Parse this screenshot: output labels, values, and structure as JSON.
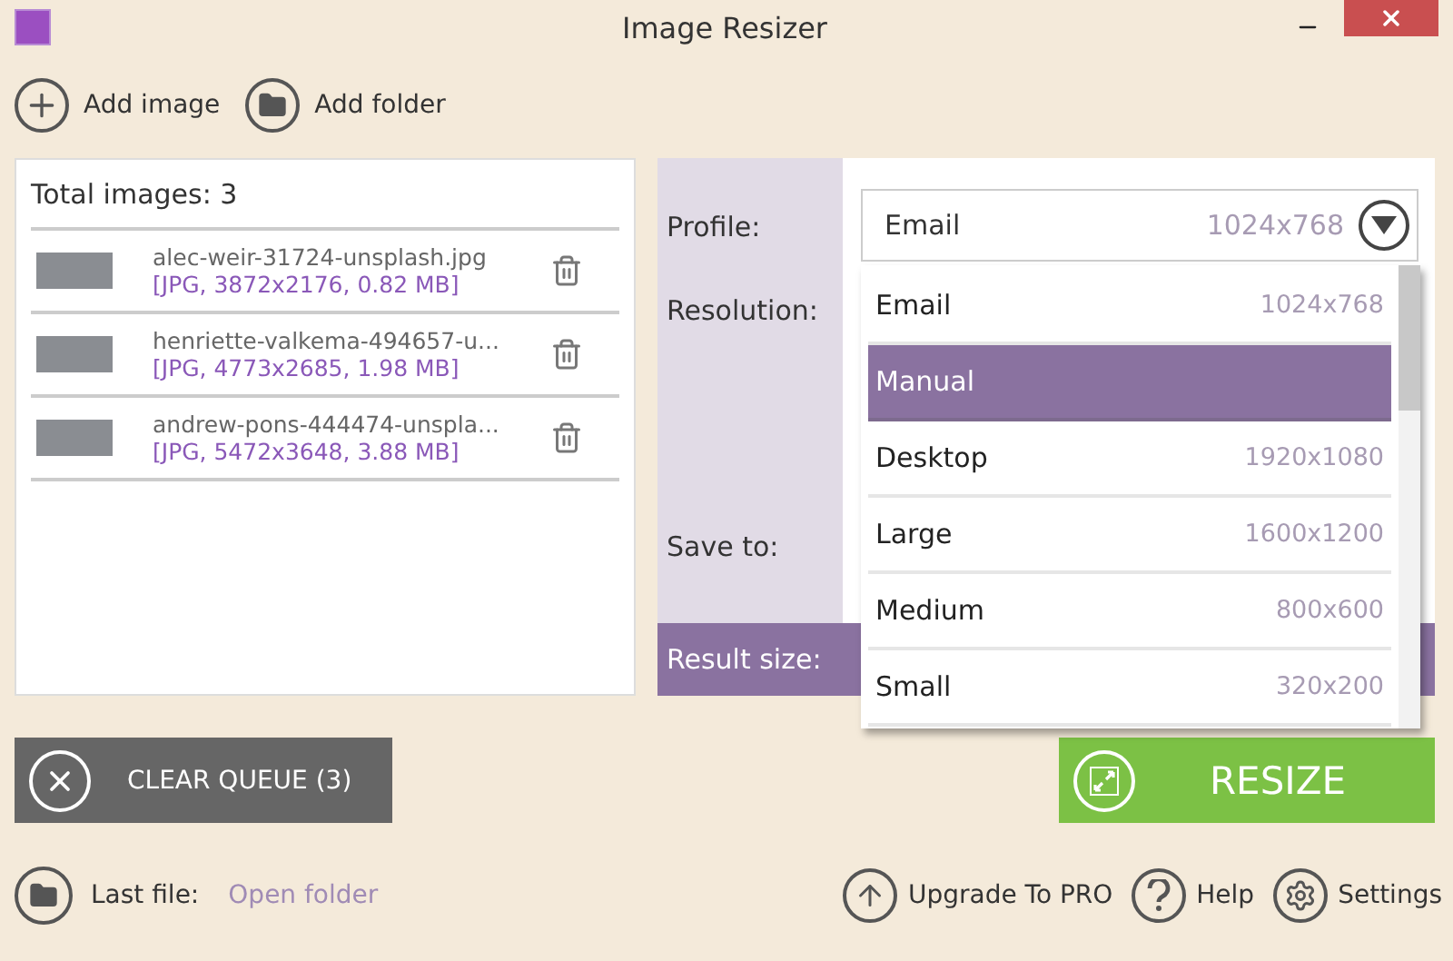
{
  "window": {
    "title": "Image Resizer"
  },
  "toolbar": [
    {
      "kind": "add",
      "label": "Add image"
    },
    {
      "kind": "folder",
      "label": "Add folder"
    }
  ],
  "queue": {
    "total": "Total images: 3",
    "files": [
      {
        "name": "alec-weir-31724-unsplash.jpg",
        "info": "[JPG, 3872x2176, 0.82 MB]"
      },
      {
        "name": "henriette-valkema-494657-u...",
        "info": "[JPG, 4773x2685, 1.98 MB]"
      },
      {
        "name": "andrew-pons-444474-unspla...",
        "info": "[JPG, 5472x3648, 3.88 MB]"
      }
    ]
  },
  "settings": {
    "labels": [
      {
        "kind": "profile",
        "text": "Profile:"
      },
      {
        "kind": "resolution",
        "text": "Resolution:"
      },
      {
        "kind": "save",
        "text": "Save to:"
      },
      {
        "kind": "result",
        "text": "Result size:"
      }
    ],
    "profile": {
      "value": "Email",
      "size": "1024x768"
    },
    "options": [
      {
        "name": "Email",
        "size": "1024x768",
        "selected": false
      },
      {
        "name": "Manual",
        "selected": true
      },
      {
        "name": "Desktop",
        "size": "1920x1080",
        "selected": false
      },
      {
        "name": "Large",
        "size": "1600x1200",
        "selected": false
      },
      {
        "name": "Medium",
        "size": "800x600",
        "selected": false
      },
      {
        "name": "Small",
        "size": "320x200",
        "selected": false
      }
    ]
  },
  "clear_button": "CLEAR QUEUE (3)",
  "resize_button": "RESIZE",
  "footer": {
    "last_file": "Last file:",
    "open_link": "Open folder",
    "links": [
      {
        "kind": "upgrade",
        "label": "Upgrade To PRO"
      },
      {
        "kind": "help",
        "label": "Help"
      },
      {
        "kind": "settings",
        "label": "Settings"
      }
    ]
  }
}
